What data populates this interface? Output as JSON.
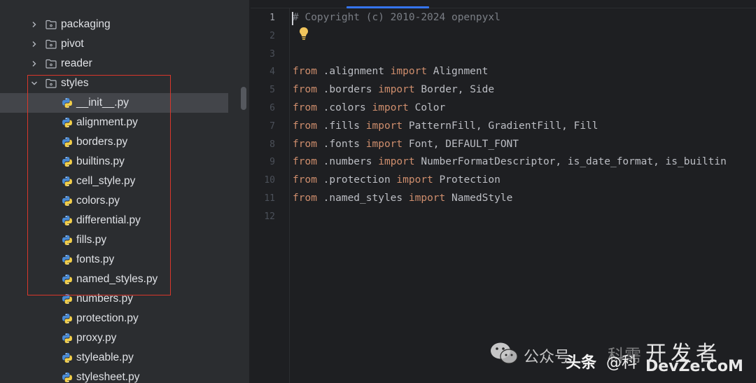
{
  "tree": {
    "rows": [
      {
        "label": "packaging",
        "kind": "folder",
        "expanded": false
      },
      {
        "label": "pivot",
        "kind": "folder",
        "expanded": false
      },
      {
        "label": "reader",
        "kind": "folder",
        "expanded": false
      },
      {
        "label": "styles",
        "kind": "folder",
        "expanded": true
      },
      {
        "label": "__init__.py",
        "kind": "file",
        "selected": true
      },
      {
        "label": "alignment.py",
        "kind": "file"
      },
      {
        "label": "borders.py",
        "kind": "file"
      },
      {
        "label": "builtins.py",
        "kind": "file"
      },
      {
        "label": "cell_style.py",
        "kind": "file"
      },
      {
        "label": "colors.py",
        "kind": "file"
      },
      {
        "label": "differential.py",
        "kind": "file"
      },
      {
        "label": "fills.py",
        "kind": "file"
      },
      {
        "label": "fonts.py",
        "kind": "file"
      },
      {
        "label": "named_styles.py",
        "kind": "file"
      },
      {
        "label": "numbers.py",
        "kind": "file"
      },
      {
        "label": "protection.py",
        "kind": "file"
      },
      {
        "label": "proxy.py",
        "kind": "file"
      },
      {
        "label": "styleable.py",
        "kind": "file"
      },
      {
        "label": "stylesheet.py",
        "kind": "file"
      }
    ]
  },
  "editor": {
    "line_numbers": [
      "1",
      "2",
      "3",
      "4",
      "5",
      "6",
      "7",
      "8",
      "9",
      "10",
      "11",
      "12"
    ],
    "lines": [
      [
        {
          "t": "# Copyright (c) 2010-2024 openpyxl",
          "c": "comment"
        }
      ],
      [],
      [],
      [
        {
          "t": "from",
          "c": "kw"
        },
        {
          "t": " .alignment "
        },
        {
          "t": "import",
          "c": "kw"
        },
        {
          "t": " Alignment"
        }
      ],
      [
        {
          "t": "from",
          "c": "kw"
        },
        {
          "t": " .borders "
        },
        {
          "t": "import",
          "c": "kw"
        },
        {
          "t": " Border, Side"
        }
      ],
      [
        {
          "t": "from",
          "c": "kw"
        },
        {
          "t": " .colors "
        },
        {
          "t": "import",
          "c": "kw"
        },
        {
          "t": " Color"
        }
      ],
      [
        {
          "t": "from",
          "c": "kw"
        },
        {
          "t": " .fills "
        },
        {
          "t": "import",
          "c": "kw"
        },
        {
          "t": " PatternFill, GradientFill, Fill"
        }
      ],
      [
        {
          "t": "from",
          "c": "kw"
        },
        {
          "t": " .fonts "
        },
        {
          "t": "import",
          "c": "kw"
        },
        {
          "t": " Font, DEFAULT_FONT"
        }
      ],
      [
        {
          "t": "from",
          "c": "kw"
        },
        {
          "t": " .numbers "
        },
        {
          "t": "import",
          "c": "kw"
        },
        {
          "t": " NumberFormatDescriptor, is_date_format, is_builtin"
        }
      ],
      [
        {
          "t": "from",
          "c": "kw"
        },
        {
          "t": " .protection "
        },
        {
          "t": "import",
          "c": "kw"
        },
        {
          "t": " Protection"
        }
      ],
      [
        {
          "t": "from",
          "c": "kw"
        },
        {
          "t": " .named_styles "
        },
        {
          "t": "import",
          "c": "kw"
        },
        {
          "t": " NamedStyle"
        }
      ],
      []
    ]
  },
  "watermark": {
    "wechat": "公众号",
    "name_partial": "科需",
    "toutiao": "头条",
    "at_handle": "@科",
    "site_cn": "开发者",
    "site_en": "DevZe.CoM"
  },
  "colors": {
    "keyword": "#cf8e6d",
    "comment": "#7a7e85",
    "annotation_box": "#d9372b",
    "tab_indicator": "#3574f0"
  }
}
